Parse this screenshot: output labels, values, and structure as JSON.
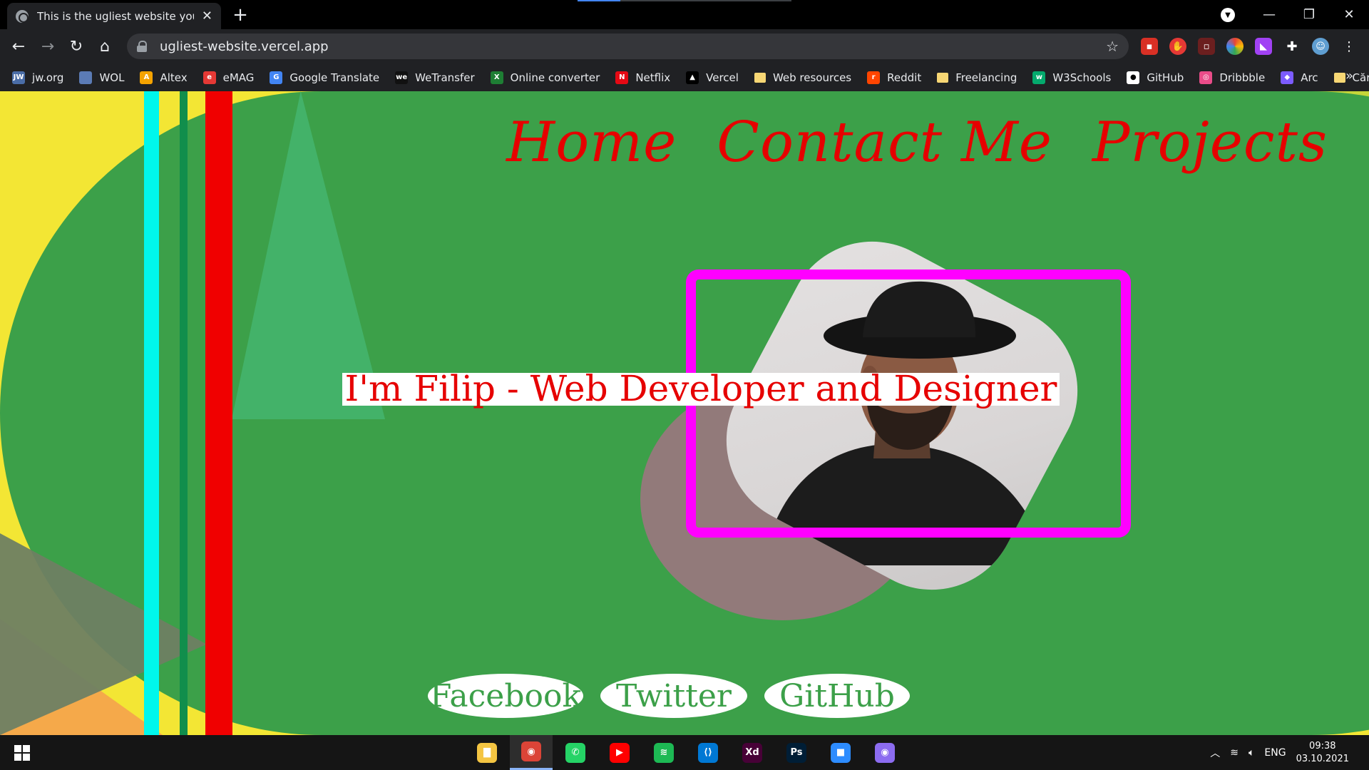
{
  "browser": {
    "tab_title": "This is the ugliest website you ha",
    "url": "ugliest-website.vercel.app",
    "bookmarks": [
      {
        "label": "jw.org",
        "icon": "jw-icon",
        "color": "#4a6da7",
        "glyph": "JW"
      },
      {
        "label": "WOL",
        "icon": "wol-icon",
        "color": "#5b7bb5",
        "glyph": ""
      },
      {
        "label": "Altex",
        "icon": "altex-icon",
        "color": "#f5a300",
        "glyph": "A"
      },
      {
        "label": "eMAG",
        "icon": "emag-icon",
        "color": "#e53935",
        "glyph": "e"
      },
      {
        "label": "Google Translate",
        "icon": "translate-icon",
        "color": "#4285f4",
        "glyph": "G"
      },
      {
        "label": "WeTransfer",
        "icon": "wetransfer-icon",
        "color": "#111111",
        "glyph": "we"
      },
      {
        "label": "Online converter",
        "icon": "converter-icon",
        "color": "#1e7e34",
        "glyph": "X"
      },
      {
        "label": "Netflix",
        "icon": "netflix-icon",
        "color": "#e50914",
        "glyph": "N"
      },
      {
        "label": "Vercel",
        "icon": "vercel-icon",
        "color": "#000000",
        "glyph": "▲"
      },
      {
        "label": "Web resources",
        "icon": "folder-icon",
        "color": "#f7d774",
        "glyph": ""
      },
      {
        "label": "Reddit",
        "icon": "reddit-icon",
        "color": "#ff4500",
        "glyph": "r"
      },
      {
        "label": "Freelancing",
        "icon": "folder-icon",
        "color": "#f7d774",
        "glyph": ""
      },
      {
        "label": "W3Schools",
        "icon": "w3schools-icon",
        "color": "#04aa6d",
        "glyph": "w"
      },
      {
        "label": "GitHub",
        "icon": "github-icon",
        "color": "#ffffff",
        "glyph": "●"
      },
      {
        "label": "Dribbble",
        "icon": "dribbble-icon",
        "color": "#ea4c89",
        "glyph": "◎"
      },
      {
        "label": "Arc",
        "icon": "arc-icon",
        "color": "#7c5cff",
        "glyph": "◆"
      },
      {
        "label": "Cărți",
        "icon": "folder-icon",
        "color": "#f7d774",
        "glyph": ""
      }
    ],
    "more_label": "»"
  },
  "page": {
    "nav": [
      "Home",
      "Contact Me",
      "Projects"
    ],
    "headline": "I'm Filip - Web Developer and Designer",
    "socials": [
      "Facebook",
      "Twitter",
      "GitHub"
    ],
    "colors": {
      "background_yellow": "#f3e634",
      "stadium_green": "#3ca049",
      "accent_red": "#e60000",
      "frame_magenta": "#ff00ff",
      "stripe_cyan": "#00f7ec"
    }
  },
  "taskbar": {
    "apps": [
      {
        "name": "file-explorer-icon",
        "color": "#f4c542",
        "glyph": "▇"
      },
      {
        "name": "chrome-icon",
        "color": "#db4437",
        "glyph": "◉"
      },
      {
        "name": "whatsapp-icon",
        "color": "#25d366",
        "glyph": "✆"
      },
      {
        "name": "youtube-icon",
        "color": "#ff0000",
        "glyph": "▶"
      },
      {
        "name": "spotify-icon",
        "color": "#1db954",
        "glyph": "≋"
      },
      {
        "name": "vscode-icon",
        "color": "#0078d4",
        "glyph": "⟨⟩"
      },
      {
        "name": "adobe-xd-icon",
        "color": "#470137",
        "glyph": "Xd"
      },
      {
        "name": "photoshop-icon",
        "color": "#001e36",
        "glyph": "Ps"
      },
      {
        "name": "zoom-icon",
        "color": "#2d8cff",
        "glyph": "■"
      },
      {
        "name": "chrome-profile-icon",
        "color": "#8c6cf0",
        "glyph": "◉"
      }
    ],
    "language": "ENG",
    "time": "09:38",
    "date": "03.10.2021"
  }
}
